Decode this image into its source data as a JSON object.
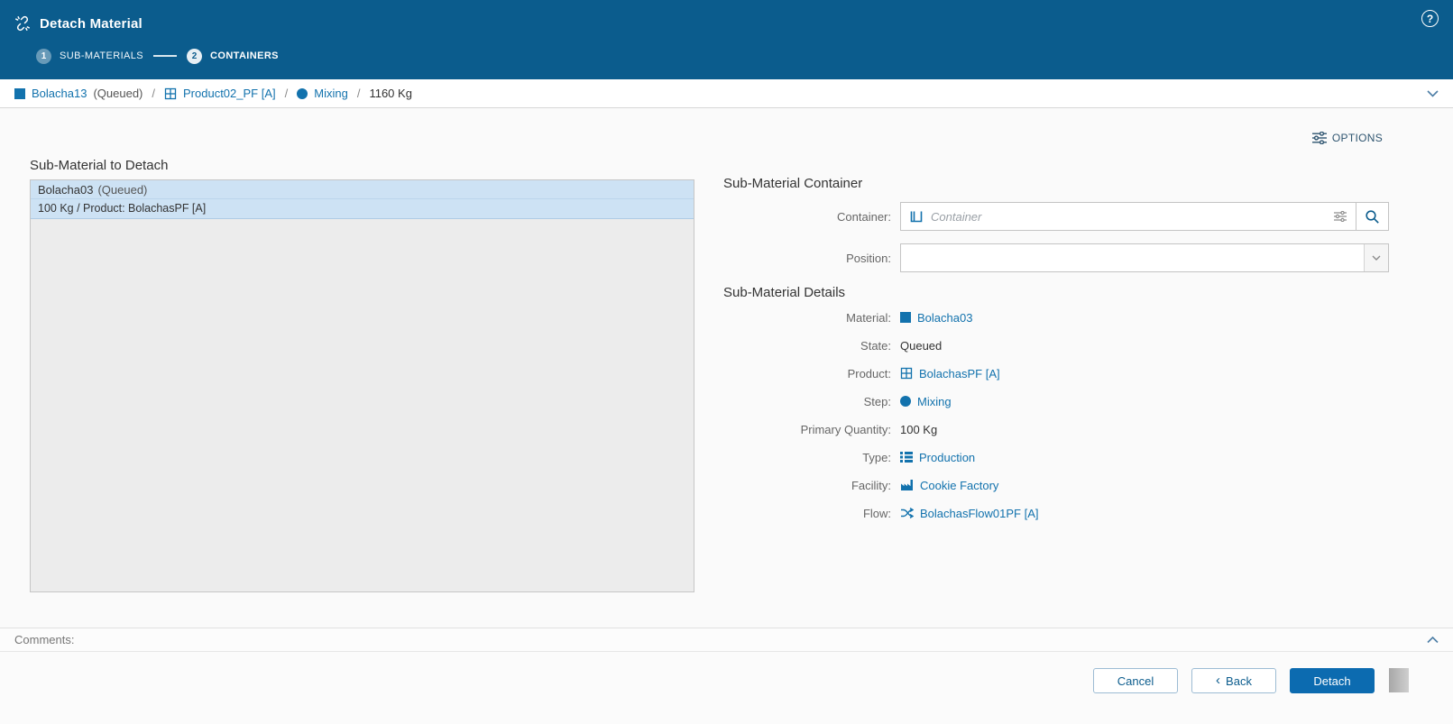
{
  "header": {
    "title": "Detach Material",
    "steps": [
      {
        "number": "1",
        "label": "SUB-MATERIALS"
      },
      {
        "number": "2",
        "label": "CONTAINERS"
      }
    ]
  },
  "icons": {
    "help_glyph": "?",
    "back_chevron": "‹",
    "names": [
      "detach-icon",
      "help-icon",
      "options-icon",
      "material-icon",
      "product-icon",
      "step-icon",
      "container-icon",
      "filter-icon",
      "search-icon",
      "dropdown-chevron-icon",
      "type-icon",
      "facility-icon",
      "flow-icon",
      "chevron-down-icon",
      "chevron-up-icon"
    ]
  },
  "breadcrumb": {
    "material": "Bolacha13",
    "material_state": "(Queued)",
    "separator": "/",
    "product": "Product02_PF [A]",
    "step": "Mixing",
    "quantity": "1160 Kg"
  },
  "toolbar": {
    "options_label": "OPTIONS"
  },
  "left_panel": {
    "title": "Sub-Material to Detach",
    "selected_item": {
      "name": "Bolacha03",
      "state": "(Queued)",
      "details": "100 Kg / Product: BolachasPF [A]"
    }
  },
  "container_section": {
    "title": "Sub-Material Container",
    "container_label": "Container:",
    "container_placeholder": "Container",
    "position_label": "Position:"
  },
  "details_section": {
    "title": "Sub-Material Details",
    "rows": [
      {
        "label": "Material:",
        "value": "Bolacha03"
      },
      {
        "label": "State:",
        "value": "Queued"
      },
      {
        "label": "Product:",
        "value": "BolachasPF [A]"
      },
      {
        "label": "Step:",
        "value": "Mixing"
      },
      {
        "label": "Primary Quantity:",
        "value": "100 Kg"
      },
      {
        "label": "Type:",
        "value": "Production"
      },
      {
        "label": "Facility:",
        "value": "Cookie Factory"
      },
      {
        "label": "Flow:",
        "value": "BolachasFlow01PF [A]"
      }
    ]
  },
  "comments": {
    "label": "Comments:"
  },
  "footer": {
    "cancel_label": "Cancel",
    "back_label": "Back",
    "detach_label": "Detach"
  },
  "colors": {
    "header_bg": "#0b5c8d",
    "link": "#1272ad",
    "selected_row_bg": "#cde2f4",
    "primary_button_bg": "#0c6bb0"
  }
}
